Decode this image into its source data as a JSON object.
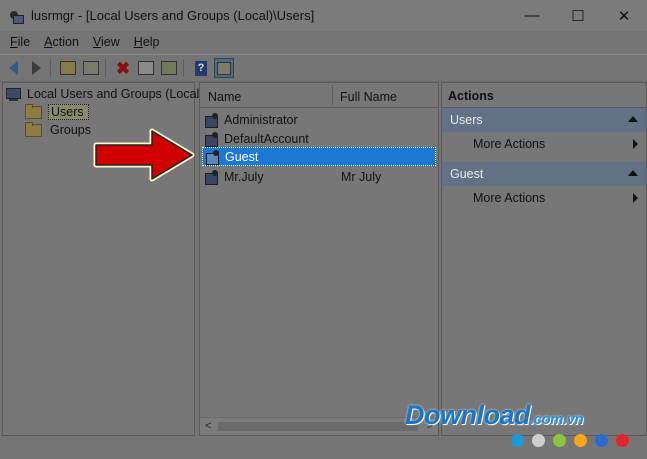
{
  "window": {
    "title": "lusrmgr - [Local Users and Groups (Local)\\Users]",
    "controls": {
      "minimize": "—",
      "maximize": "☐",
      "close": "✕"
    }
  },
  "menu": [
    "File",
    "Action",
    "View",
    "Help"
  ],
  "toolbar_icons": [
    "back-icon",
    "forward-icon",
    "up-folder-icon",
    "show-hide-tree-icon",
    "delete-icon",
    "properties-icon",
    "export-icon",
    "help-icon",
    "show-hide-action-pane-icon"
  ],
  "tree": {
    "root": "Local Users and Groups (Local)",
    "children": [
      "Users",
      "Groups"
    ],
    "selected": "Users"
  },
  "list": {
    "columns": {
      "name": "Name",
      "full_name": "Full Name"
    },
    "rows": [
      {
        "name": "Administrator",
        "full_name": ""
      },
      {
        "name": "DefaultAccount",
        "full_name": ""
      },
      {
        "name": "Guest",
        "full_name": ""
      },
      {
        "name": "Mr.July",
        "full_name": "Mr July"
      }
    ],
    "selected": "Guest",
    "scroll_left": "<",
    "scroll_right": ">"
  },
  "actions": {
    "title": "Actions",
    "sections": [
      {
        "label": "Users",
        "item": "More Actions"
      },
      {
        "label": "Guest",
        "item": "More Actions"
      }
    ]
  },
  "watermark": {
    "text": "Download",
    "suffix": ".com.vn"
  },
  "colors": {
    "selection": "#1d77d4",
    "section_header": "#627186",
    "arrow": "#d10000",
    "dots": [
      "#1a9bd8",
      "#cfcfcf",
      "#8cc63f",
      "#f7a51c",
      "#2a6bd0",
      "#e0262b"
    ]
  }
}
